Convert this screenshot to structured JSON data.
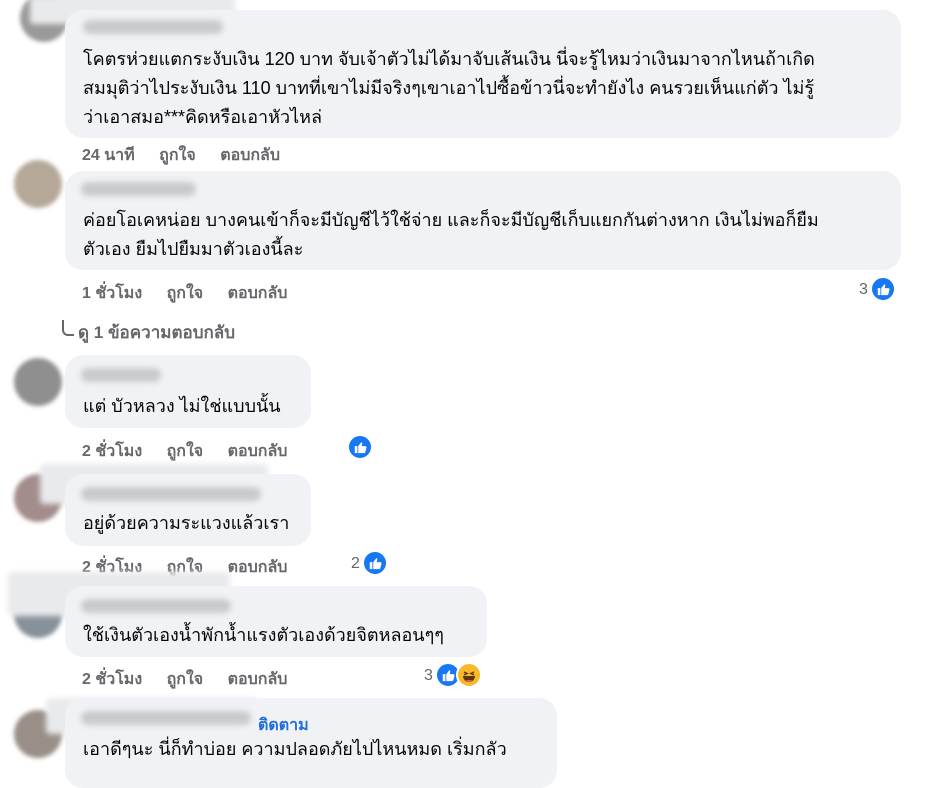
{
  "comments": [
    {
      "lines": [
        "โคตรห่วยแตกระงับเงิน 120 บาท จับเจ้าตัวไม่ได้มาจับเส้นเงิน นี่จะรู้ไหมว่าเงินมาจากไหนถ้าเกิด",
        "สมมุติว่าไประงับเงิน 110 บาทที่เขาไม่มีจริงๆเขาเอาไปซื้อข้าวนี่จะทำยังไง คนรวยเห็นแก่ตัว ไม่รู้",
        "ว่าเอาสมอ***คิดหรือเอาหัวไหล่"
      ],
      "time": "24 นาที",
      "like_label": "ถูกใจ",
      "reply_label": "ตอบกลับ"
    },
    {
      "lines": [
        "ค่อยโอเคหน่อย บางคนเข้าก็จะมีบัญชีไว้ใช้จ่าย และก็จะมีบัญชีเก็บแยกกันต่างหาก เงินไม่พอก็ยืม",
        "ตัวเอง ยืมไปยืมมาตัวเองนี้ละ"
      ],
      "time": "1 ชั่วโมง",
      "like_label": "ถูกใจ",
      "reply_label": "ตอบกลับ",
      "reaction_count": "3"
    },
    {
      "lines": [
        "แต่ บัวหลวง ไม่ใช่แบบนั้น"
      ],
      "time": "2 ชั่วโมง",
      "like_label": "ถูกใจ",
      "reply_label": "ตอบกลับ"
    },
    {
      "lines": [
        "อยู่ด้วยความระแวงแล้วเรา"
      ],
      "time": "2 ชั่วโมง",
      "like_label": "ถูกใจ",
      "reply_label": "ตอบกลับ",
      "reaction_count": "2"
    },
    {
      "lines": [
        "ใช้เงินตัวเองน้ำพักน้ำแรงตัวเองด้วยจิตหลอนๆๆ"
      ],
      "time": "2 ชั่วโมง",
      "like_label": "ถูกใจ",
      "reply_label": "ตอบกลับ",
      "reaction_count": "3"
    },
    {
      "lines": [
        "เอาดีๆนะ นี่ก็ทำบ่อย ความปลอดภัยไปไหนหมด เริ่มกลัว"
      ],
      "follow_label": "ติดตาม"
    }
  ],
  "view_replies": "ดู 1 ข้อความตอบกลับ",
  "icons": {
    "like": "like-icon",
    "haha": "haha-icon",
    "reply_arrow": "reply-arrow-icon"
  },
  "colors": {
    "bubble": "#f0f2f5",
    "like_blue": "#1877f2",
    "meta_gray": "#65676b",
    "link_blue": "#216fdb"
  }
}
